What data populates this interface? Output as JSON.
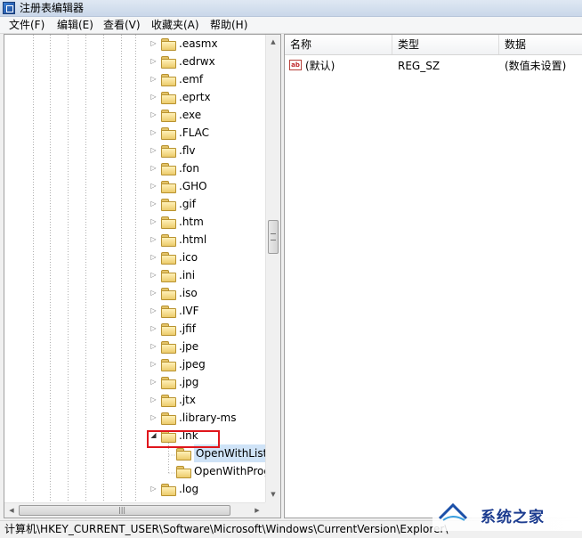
{
  "window": {
    "title": "注册表编辑器",
    "icon": "registry-editor-icon"
  },
  "menu": [
    "文件(F)",
    "编辑(E)",
    "查看(V)",
    "收藏夹(A)",
    "帮助(H)"
  ],
  "tree": {
    "items": [
      ".easmx",
      ".edrwx",
      ".emf",
      ".eprtx",
      ".exe",
      ".FLAC",
      ".flv",
      ".fon",
      ".GHO",
      ".gif",
      ".htm",
      ".html",
      ".ico",
      ".ini",
      ".iso",
      ".IVF",
      ".jfif",
      ".jpe",
      ".jpeg",
      ".jpg",
      ".jtx",
      ".library-ms",
      ".lnk",
      "OpenWithList",
      "OpenWithProgids",
      ".log"
    ],
    "highlighted": ".lnk",
    "selected": "OpenWithList",
    "expanded_icon": "expanded-triangle-icon",
    "collapsed_icon": "collapsed-triangle-icon"
  },
  "list": {
    "columns": [
      "名称",
      "类型",
      "数据"
    ],
    "rows": [
      {
        "name": "(默认)",
        "type": "REG_SZ",
        "data": "(数值未设置)",
        "icon": "ab-string-value-icon"
      }
    ]
  },
  "status": {
    "path": "计算机\\HKEY_CURRENT_USER\\Software\\Microsoft\\Windows\\CurrentVersion\\Explorer\\"
  },
  "watermark": {
    "text": "系统之家"
  },
  "colors": {
    "highlight_box": "#e0161c",
    "selection": "#cfe3f7",
    "folder": "#eccb6b"
  }
}
